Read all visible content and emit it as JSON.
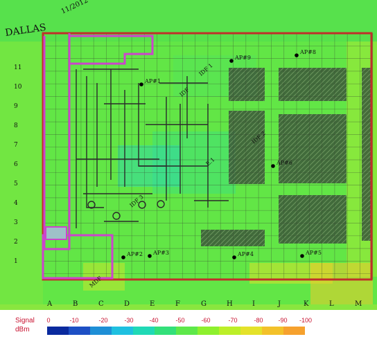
{
  "map": {
    "handwritten": {
      "city": "DALLAS",
      "date": "11/2012"
    },
    "grid": {
      "columns": [
        "A",
        "B",
        "C",
        "D",
        "E",
        "F",
        "G",
        "H",
        "I",
        "J",
        "K",
        "L",
        "M"
      ],
      "rows": [
        "11",
        "10",
        "9",
        "8",
        "7",
        "6",
        "5",
        "4",
        "3",
        "2",
        "1"
      ]
    },
    "access_points": [
      {
        "label": "AP#9"
      },
      {
        "label": "AP#8"
      },
      {
        "label": "AP#1"
      },
      {
        "label": "AP#2"
      },
      {
        "label": "AP#3"
      },
      {
        "label": "AP#4"
      },
      {
        "label": "AP#5"
      },
      {
        "label": "AP#6"
      }
    ],
    "annotations": [
      "IDF 1",
      "IDF 2",
      "IDF 3",
      "MDF",
      "IDF",
      "E.1"
    ],
    "colors": {
      "building_outline": "#cc44cc",
      "wall_red": "#c0302a",
      "gridline": "#3a4a33",
      "dark_block": "#2e4a32",
      "ap_marker": "#000000"
    }
  },
  "legend": {
    "title": "Signal",
    "unit": "dBm",
    "ticks": [
      "0",
      "-10",
      "-20",
      "-30",
      "-40",
      "-50",
      "-60",
      "-70",
      "-80",
      "-90",
      "-100"
    ],
    "colors": [
      "#0a2a9e",
      "#1d4fc4",
      "#1e8fd6",
      "#1fc0e0",
      "#20d9b6",
      "#33e07a",
      "#5ee84a",
      "#8ef02e",
      "#bcef28",
      "#e4e22a",
      "#f3c12a",
      "#f6a12e"
    ]
  }
}
